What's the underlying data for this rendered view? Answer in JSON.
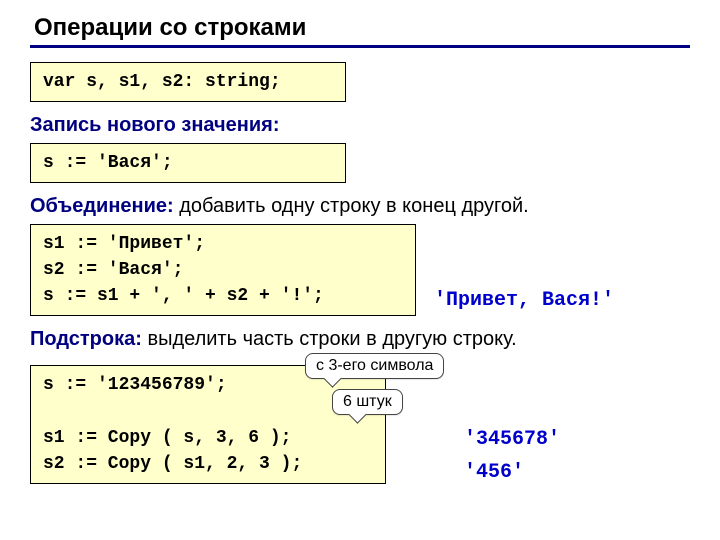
{
  "title": "Операции со строками",
  "code1": "var s, s1, s2: string;",
  "section1": {
    "label": "Запись нового значения:"
  },
  "code2": "s := 'Вася';",
  "section2": {
    "label": "Объединение:",
    "desc": " добавить одну строку в конец другой."
  },
  "code3": {
    "l1": "s1 := 'Привет';",
    "l2": "s2 := 'Вася';",
    "l3": "s := s1 + ', ' + s2 + '!';"
  },
  "result1": "'Привет, Вася!'",
  "section3": {
    "label": "Подстрока:",
    "desc": " выделить часть строки в другую строку."
  },
  "code4": {
    "l1": "s := '123456789';",
    "l2": "s1 := Copy ( s, 3, 6 );",
    "l3": "s2 := Copy ( s1, 2, 3 );"
  },
  "callout1": "с 3-его символа",
  "callout2": "6 штук",
  "result2": "'345678'",
  "result3": "'456'"
}
